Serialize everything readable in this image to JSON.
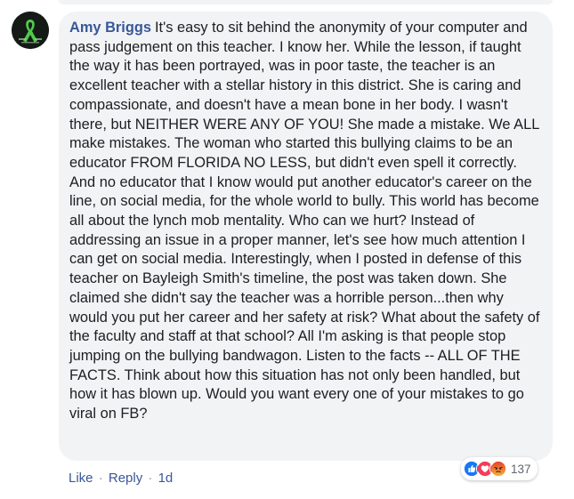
{
  "comment": {
    "author": "Amy Briggs",
    "text": "It's easy to sit behind the anonymity of your computer and pass judgement on this teacher. I know her. While the lesson, if taught the way it has been portrayed, was in poor taste, the teacher is an excellent teacher with a stellar history in this district. She is caring and compassionate, and doesn't have a mean bone in her body. I wasn't there, but NEITHER WERE ANY OF YOU! She made a mistake. We ALL make mistakes. The woman who started this bullying claims to be an educator FROM FLORIDA NO LESS, but didn't even spell it correctly. And no educator that I know would put another educator's career on the line, on social media, for the whole world to bully. This world has become all about the lynch mob mentality. Who can we hurt? Instead of addressing an issue in a proper manner, let's see how much attention I can get on social media. Interestingly, when I posted in defense of this teacher on Bayleigh Smith's timeline, the post was taken down. She claimed she didn't say the teacher was a horrible person...then why would you put her career and her safety at risk? What about the safety of the faculty and staff at that school? All I'm asking is that people stop jumping on the bullying bandwagon. Listen to the facts -- ALL OF THE FACTS. Think about how this situation has not only been handled, but how it has blown up. Would you want every one of your mistakes to go viral on FB?",
    "avatar_icon": "green-awareness-ribbon-icon"
  },
  "reactions": {
    "icons": [
      "like-icon",
      "love-icon",
      "angry-icon"
    ],
    "count": "137"
  },
  "actions": {
    "like_label": "Like",
    "reply_label": "Reply",
    "separator": "·",
    "timestamp": "1d"
  },
  "colors": {
    "bubble_bg": "#f2f3f5",
    "author_link": "#385898",
    "body_text": "#1c1e21",
    "meta_text": "#606770",
    "like_blue": "#1877f2",
    "love_red": "#f33e58",
    "angry_orange": "#e9710f"
  }
}
